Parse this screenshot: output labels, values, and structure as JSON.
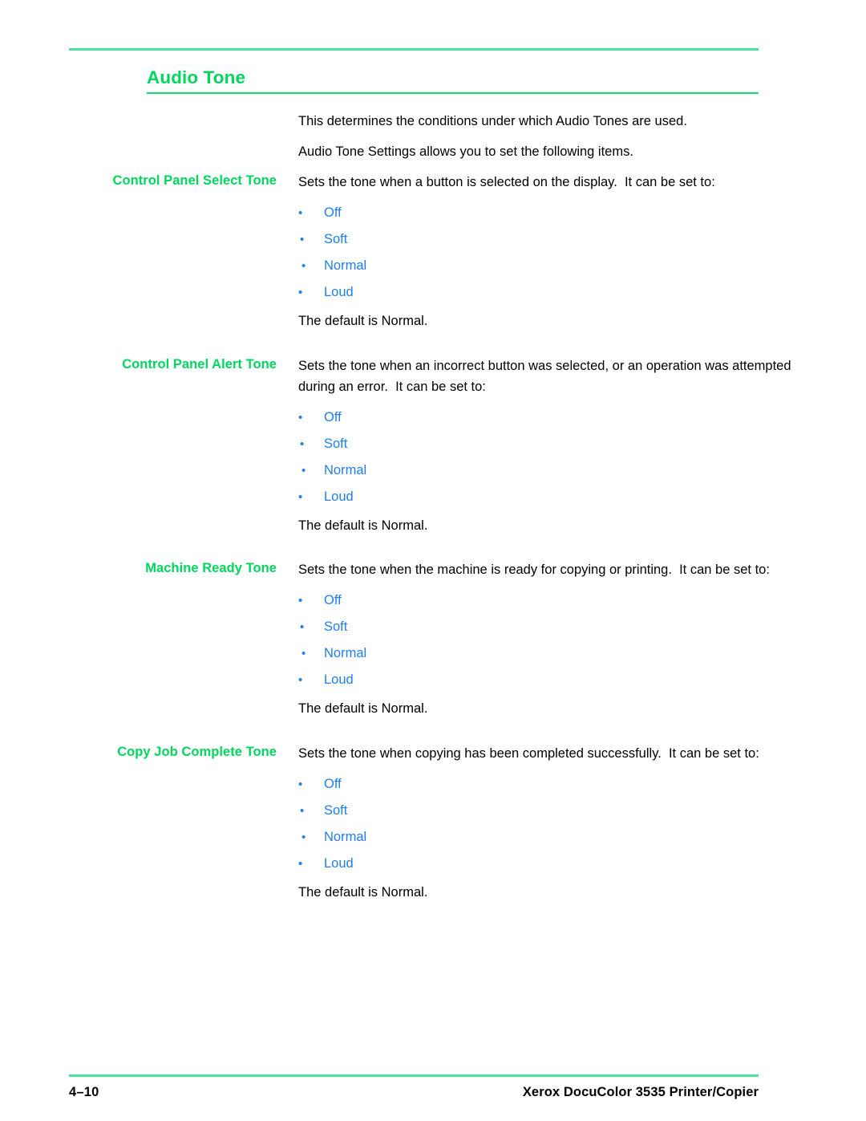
{
  "page": {
    "heading": "Audio Tone",
    "accent_green_heading": "#00d65e",
    "accent_green_rule": "#4de39a",
    "accent_blue_list": "#1f7fe8",
    "bullet_glyph": "•"
  },
  "intro": {
    "paragraph_1": "This determines the conditions under which Audio Tones are used.",
    "paragraph_2": "Audio Tone Settings allows you to set the following items."
  },
  "sections": [
    {
      "label": "Control Panel Select Tone",
      "description": "Sets the tone when a button is selected on the display.  It can be set to:",
      "options": [
        "Off",
        "Soft",
        "Normal",
        "Loud"
      ],
      "default_note": "The default is Normal."
    },
    {
      "label": "Control Panel Alert Tone",
      "description": "Sets the tone when an incorrect button was selected, or an operation was attempted during an error.  It can be set to:",
      "options": [
        "Off",
        "Soft",
        "Normal",
        "Loud"
      ],
      "default_note": "The default is Normal."
    },
    {
      "label": "Machine Ready Tone",
      "description": "Sets the tone when the machine is ready for copying or printing.  It can be set to:",
      "options": [
        "Off",
        "Soft",
        "Normal",
        "Loud"
      ],
      "default_note": "The default is Normal."
    },
    {
      "label": "Copy Job Complete Tone",
      "description": "Sets the tone when copying has been completed successfully.  It can be set to:",
      "options": [
        "Off",
        "Soft",
        "Normal",
        "Loud"
      ],
      "default_note": "The default is Normal."
    }
  ],
  "footer": {
    "page_number": "4–10",
    "product": "Xerox DocuColor 3535 Printer/Copier"
  }
}
